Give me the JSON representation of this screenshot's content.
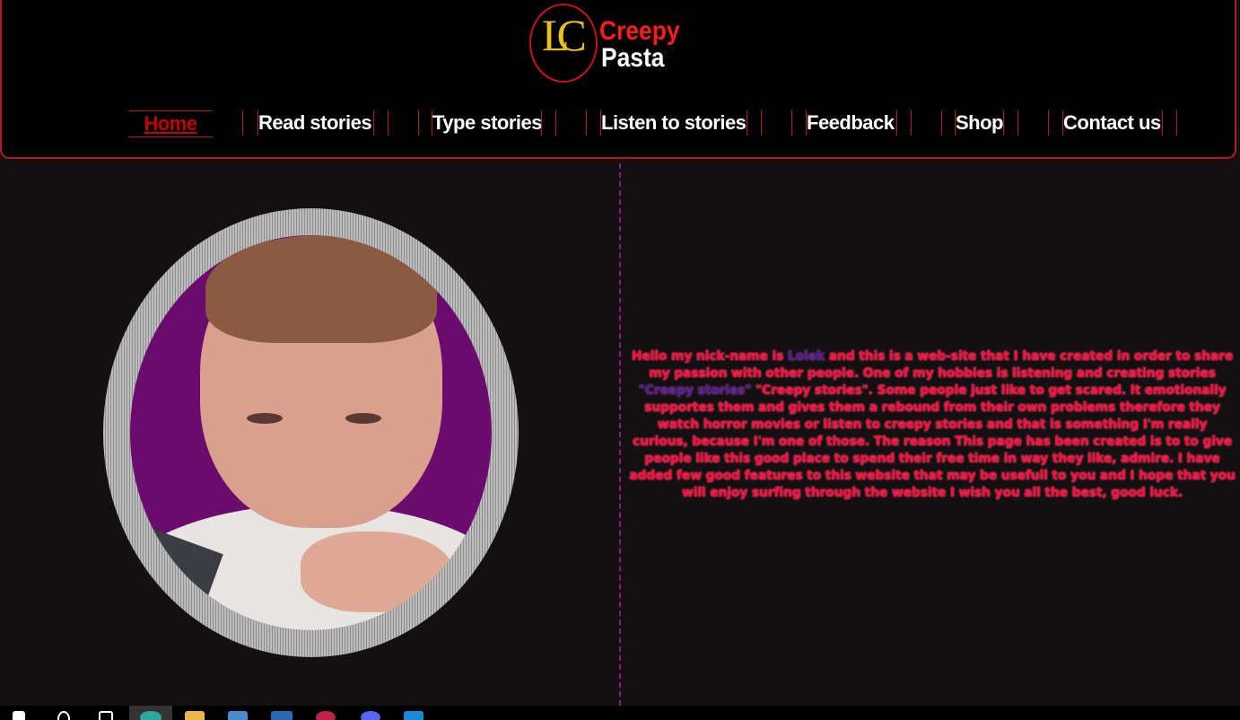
{
  "logo": {
    "monogram": "LC",
    "word1": "Creepy",
    "word2": "Pasta"
  },
  "nav": {
    "items": [
      {
        "label": "Home",
        "active": true
      },
      {
        "label": "Read stories",
        "active": false
      },
      {
        "label": "Type stories",
        "active": false
      },
      {
        "label": "Listen to stories",
        "active": false
      },
      {
        "label": "Feedback",
        "active": false
      },
      {
        "label": "Shop",
        "active": false
      },
      {
        "label": "Contact us",
        "active": false
      }
    ]
  },
  "bio": {
    "part1": "Hello my nick-name is ",
    "nick": "Lolek",
    "part2": " and this is a web-site that I have created in order to share my passion with other people. One of my hobbies is listening and creating stories ",
    "quote": "\"Creepy stories\"",
    "part3": " \"Creepy stories\". Some people just like to get scared. It emotionally supportes them and gives them a rebound from their own problems therefore they watch horror movies or listen to creepy stories and that is something I'm really curious, because I'm one of those. The reason This page has been created is to to give people like this good place to spend their free time in way they like, admire. I have added few good features to this website that may be usefull to you and I hope that you will enjoy surfing through the website I wish you all the best, good luck."
  },
  "colors": {
    "accent_red": "#ff0a3a",
    "nav_active": "#c80000",
    "divider": "#8a1a8a",
    "portrait_bg": "#6b0b6e"
  },
  "taskbar": {
    "icons": [
      "windows-start-icon",
      "search-icon",
      "task-view-icon",
      "edge-browser-icon",
      "file-explorer-icon",
      "store-icon",
      "mail-icon",
      "opera-icon",
      "discord-icon",
      "vscode-icon"
    ]
  }
}
